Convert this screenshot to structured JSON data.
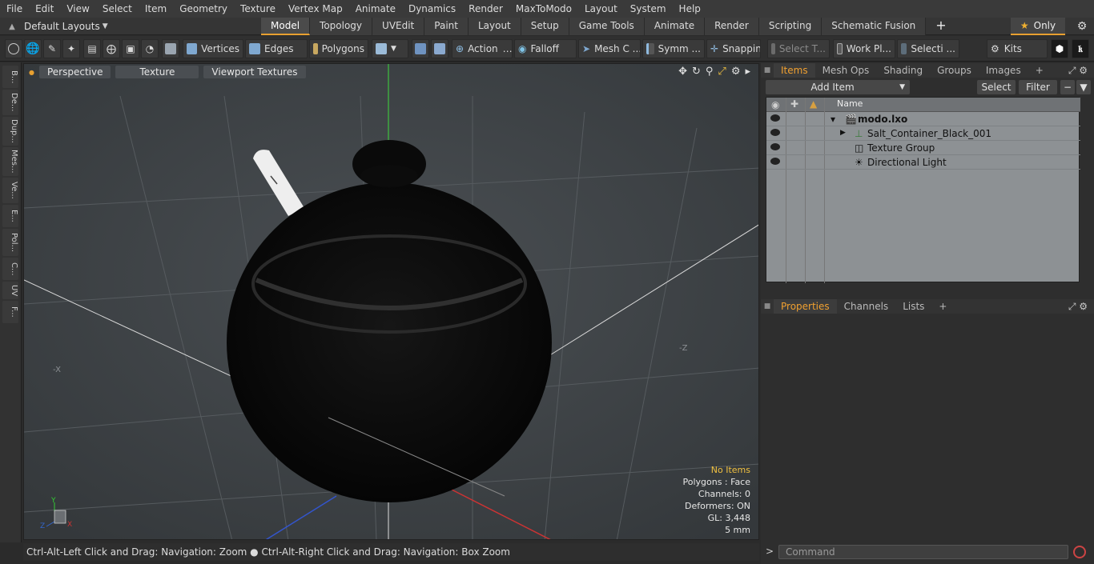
{
  "menu": [
    "File",
    "Edit",
    "View",
    "Select",
    "Item",
    "Geometry",
    "Texture",
    "Vertex Map",
    "Animate",
    "Dynamics",
    "Render",
    "MaxToModo",
    "Layout",
    "System",
    "Help"
  ],
  "layouts_label": "Default Layouts",
  "tabs": [
    "Model",
    "Topology",
    "UVEdit",
    "Paint",
    "Layout",
    "Setup",
    "Game Tools",
    "Animate",
    "Render",
    "Scripting",
    "Schematic Fusion"
  ],
  "only_label": "Only",
  "toolbar": {
    "vertices": "Vertices",
    "edges": "Edges",
    "polygons": "Polygons",
    "action": "Action",
    "falloff": "Falloff",
    "mesh": "Mesh C ...",
    "symm": "Symm ...",
    "snapping": "Snapping",
    "select_t": "Select T...",
    "work_pl": "Work Pl...",
    "selecti": "Selecti ...",
    "kits": "Kits"
  },
  "left_tabs": [
    "B...",
    "De...",
    "Dup...",
    "Mes...",
    "Ve...",
    "E...",
    "Pol...",
    "C...",
    "UV",
    "F..."
  ],
  "viewport": {
    "perspective": "Perspective",
    "texture": "Texture",
    "viewport_textures": "Viewport Textures",
    "info": {
      "no_items": "No Items",
      "polygons": "Polygons : Face",
      "channels": "Channels: 0",
      "deformers": "Deformers: ON",
      "gl": "GL: 3,448",
      "scale": "5 mm"
    }
  },
  "status": "Ctrl-Alt-Left Click and Drag: Navigation: Zoom ● Ctrl-Alt-Right Click and Drag: Navigation: Box Zoom",
  "panel": {
    "tabs": [
      "Items",
      "Mesh Ops",
      "Shading",
      "Groups",
      "Images"
    ],
    "add_item": "Add Item",
    "select": "Select",
    "filter": "Filter",
    "name_col": "Name",
    "items": [
      {
        "label": "modo.lxo"
      },
      {
        "label": "Salt_Container_Black_001"
      },
      {
        "label": "Texture Group"
      },
      {
        "label": "Directional Light"
      }
    ],
    "bottom_tabs": [
      "Properties",
      "Channels",
      "Lists"
    ],
    "command_placeholder": "Command"
  }
}
